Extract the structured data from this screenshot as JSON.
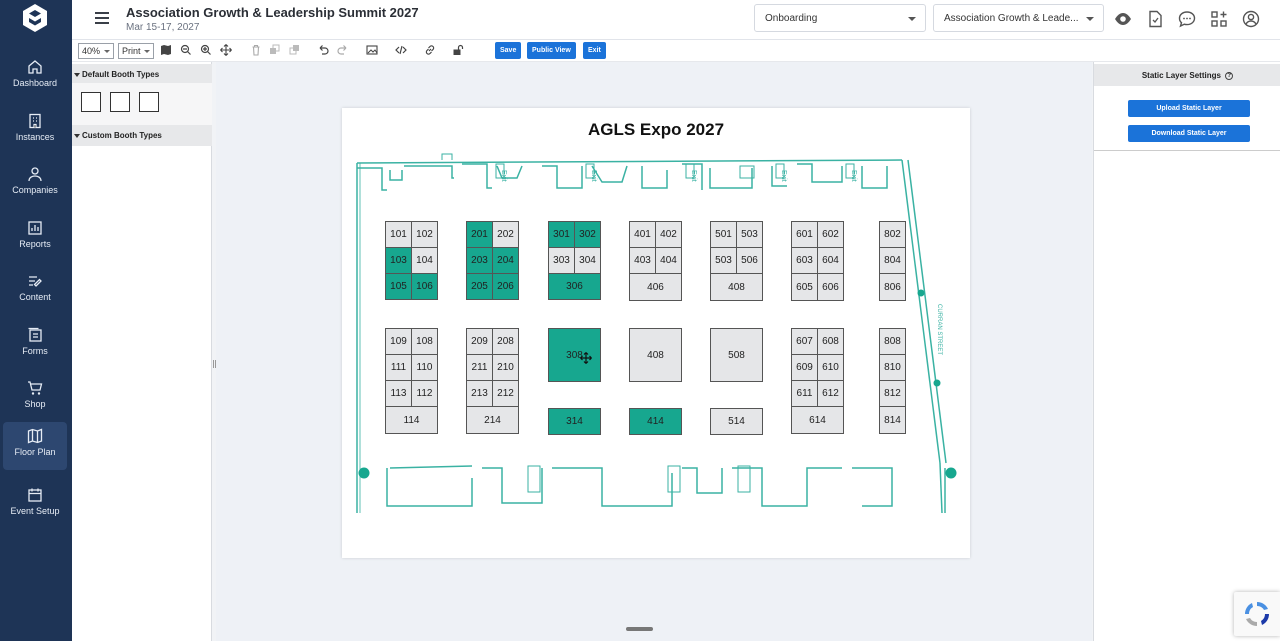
{
  "nav": {
    "items": [
      {
        "label": "Dashboard",
        "icon": "home-icon"
      },
      {
        "label": "Instances",
        "icon": "building-icon"
      },
      {
        "label": "Companies",
        "icon": "people-icon"
      },
      {
        "label": "Reports",
        "icon": "chart-icon"
      },
      {
        "label": "Content",
        "icon": "edit-list-icon"
      },
      {
        "label": "Forms",
        "icon": "forms-icon"
      },
      {
        "label": "Shop",
        "icon": "cart-icon"
      },
      {
        "label": "Floor Plan",
        "icon": "map-icon"
      },
      {
        "label": "Event Setup",
        "icon": "calendar-icon"
      }
    ],
    "active": "Floor Plan"
  },
  "header": {
    "title": "Association Growth & Leadership Summit 2027",
    "date": "Mar 15-17, 2027",
    "select_onboarding": "Onboarding",
    "select_event": "Association Growth & Leade..."
  },
  "toolbar": {
    "zoom": "40%",
    "print": "Print",
    "save_label": "Save",
    "public_view_label": "Public View",
    "exit_label": "Exit"
  },
  "left_panel": {
    "default_booth_types": "Default Booth Types",
    "custom_booth_types": "Custom Booth Types"
  },
  "floor_plan": {
    "title": "AGLS Expo 2027",
    "exit_labels": [
      "Exit",
      "Exit",
      "Exit",
      "Exit",
      "Exit"
    ],
    "street_label": "CURRAN STREET",
    "booths": [
      "101",
      "102",
      "103",
      "104",
      "105",
      "106",
      "109",
      "108",
      "111",
      "110",
      "113",
      "112",
      "114",
      "201",
      "202",
      "203",
      "204",
      "205",
      "206",
      "209",
      "208",
      "211",
      "210",
      "213",
      "212",
      "214",
      "301",
      "302",
      "303",
      "304",
      "306",
      "308",
      "314",
      "401",
      "402",
      "403",
      "404",
      "406",
      "408",
      "414",
      "501",
      "503",
      "503",
      "506",
      "408",
      "508",
      "514",
      "601",
      "602",
      "603",
      "604",
      "605",
      "606",
      "607",
      "608",
      "609",
      "610",
      "611",
      "612",
      "614",
      "802",
      "804",
      "806",
      "808",
      "810",
      "812",
      "814"
    ],
    "sold_booths": [
      "201",
      "203",
      "204",
      "205",
      "206",
      "301",
      "302",
      "306",
      "308",
      "314",
      "414",
      "103",
      "105",
      "106"
    ],
    "colors": {
      "sold": "#17a78f",
      "available": "#e5e6e8",
      "walls": "#3ab2a3"
    }
  },
  "right_panel": {
    "title": "Static Layer Settings",
    "upload_label": "Upload Static Layer",
    "download_label": "Download Static Layer"
  }
}
